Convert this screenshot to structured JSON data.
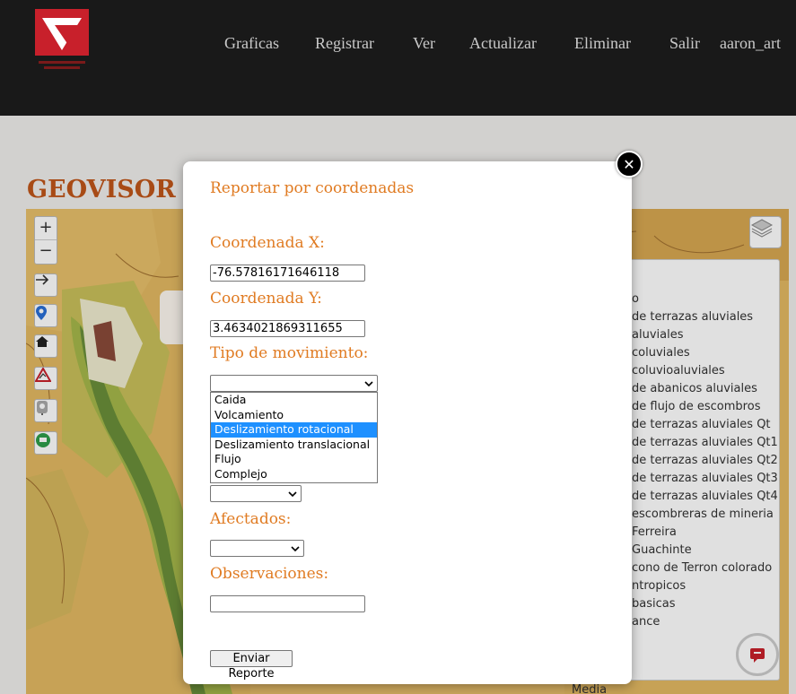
{
  "navbar": {
    "items": [
      "Graficas",
      "Registrar",
      "Ver",
      "Actualizar",
      "Eliminar",
      "Salir",
      "aaron_art"
    ]
  },
  "page": {
    "title": "GEOVISOR F"
  },
  "map": {
    "legend_items": [
      "o",
      "de terrazas aluviales",
      "aluviales",
      "coluviales",
      "coluvioaluviales",
      "de abanicos aluviales",
      "de flujo de escombros",
      "de terrazas aluviales Qt",
      "de terrazas aluviales Qt1",
      "de terrazas aluviales Qt2",
      "de terrazas aluviales Qt3",
      "de terrazas aluviales Qt4",
      "escombreras de mineria",
      "Ferreira",
      "Guachinte",
      "cono de Terron colorado",
      "ntropicos",
      "basicas",
      "ance"
    ],
    "legend_bottom": "Media"
  },
  "modal": {
    "title": "Reportar por coordenadas",
    "coord_x_label": "Coordenada X:",
    "coord_x_value": "-76.57816171646118",
    "coord_y_label": "Coordenada Y:",
    "coord_y_value": "3.4634021869311655",
    "movement_label": "Tipo de movimiento:",
    "movement_selected": "",
    "movement_options": [
      "Caida",
      "Volcamiento",
      "Deslizamiento rotacional",
      "Deslizamiento translacional",
      "Flujo",
      "Complejo"
    ],
    "movement_highlighted_index": 2,
    "affected_label": "Afectados:",
    "observations_label": "Observaciones:",
    "observations_value": "",
    "submit_label": "Enviar Reporte",
    "close_symbol": "✕"
  },
  "colors": {
    "accent": "#e07b22",
    "title_brand": "#c0561a",
    "navbar_bg": "#191919",
    "selected_option": "#1e90ff"
  }
}
